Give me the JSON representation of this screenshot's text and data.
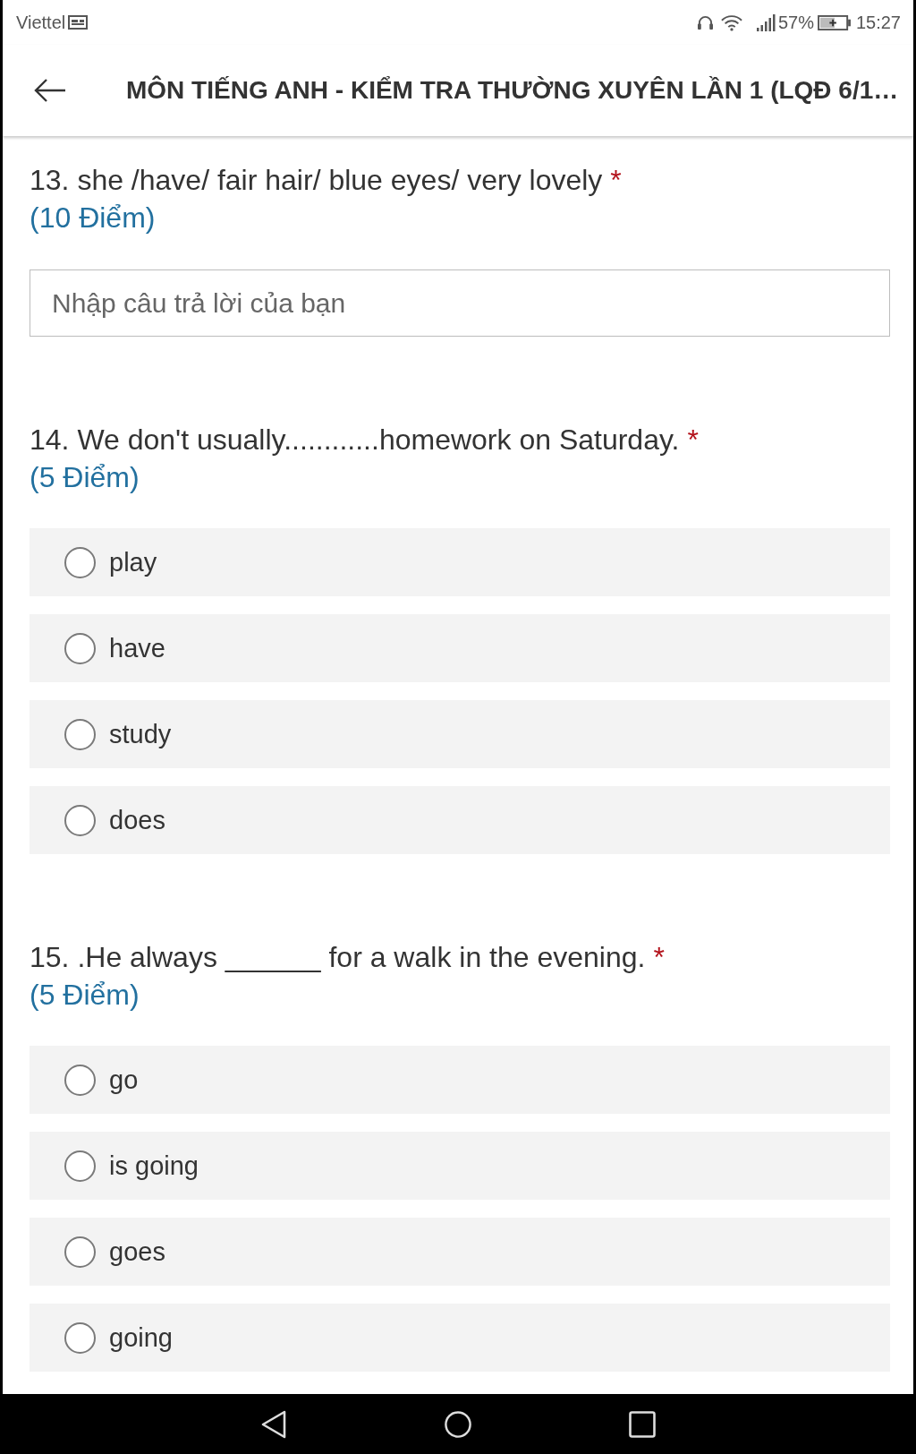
{
  "status_bar": {
    "carrier": "Viettel",
    "battery_percent": "57%",
    "time": "15:27"
  },
  "header": {
    "title": "MÔN TIẾNG ANH - KIỂM TRA THƯỜNG XUYÊN LẦN 1 (LQĐ 6/1…"
  },
  "questions": [
    {
      "kind": "text",
      "title": "13. she /have/ fair hair/ blue eyes/ very lovely",
      "required_mark": "*",
      "points": "(10 Điểm)",
      "answer": {
        "placeholder": "Nhập câu trả lời của bạn"
      }
    },
    {
      "kind": "choice",
      "title": "14. We don't usually............homework on Saturday.",
      "required_mark": "*",
      "points": "(5 Điểm)",
      "options": [
        {
          "label": "play",
          "selected": false
        },
        {
          "label": "have",
          "selected": false
        },
        {
          "label": "study",
          "selected": false
        },
        {
          "label": "does",
          "selected": false
        }
      ]
    },
    {
      "kind": "choice",
      "title": "15. .He always ______ for a walk in the evening.",
      "required_mark": "*",
      "points": "(5 Điểm)",
      "options": [
        {
          "label": "go",
          "selected": false
        },
        {
          "label": "is going",
          "selected": false
        },
        {
          "label": "goes",
          "selected": false
        },
        {
          "label": "going",
          "selected": false
        }
      ]
    }
  ]
}
